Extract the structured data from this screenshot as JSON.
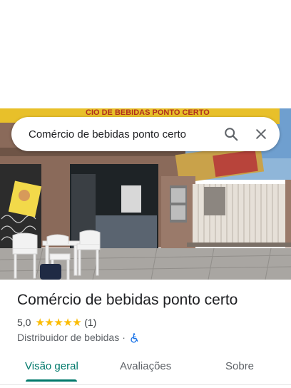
{
  "search": {
    "query": "Comércio de bebidas ponto certo",
    "search_icon": "search-icon",
    "close_icon": "close-icon"
  },
  "photo": {
    "sign_text": "CIO DE BEBIDAS PONTO CERTO",
    "subject": "storefront-photo"
  },
  "place": {
    "name": "Comércio de bebidas ponto certo",
    "rating": "5,0",
    "stars": 5,
    "review_count": "(1)",
    "category": "Distribuidor de bebidas",
    "separator": "·",
    "accessibility_icon": "wheelchair-icon"
  },
  "tabs": [
    {
      "label": "Visão geral",
      "active": true
    },
    {
      "label": "Avaliações",
      "active": false
    },
    {
      "label": "Sobre",
      "active": false
    }
  ],
  "colors": {
    "accent": "#00796b",
    "star": "#fbbc04",
    "accessibility": "#1a73e8"
  }
}
